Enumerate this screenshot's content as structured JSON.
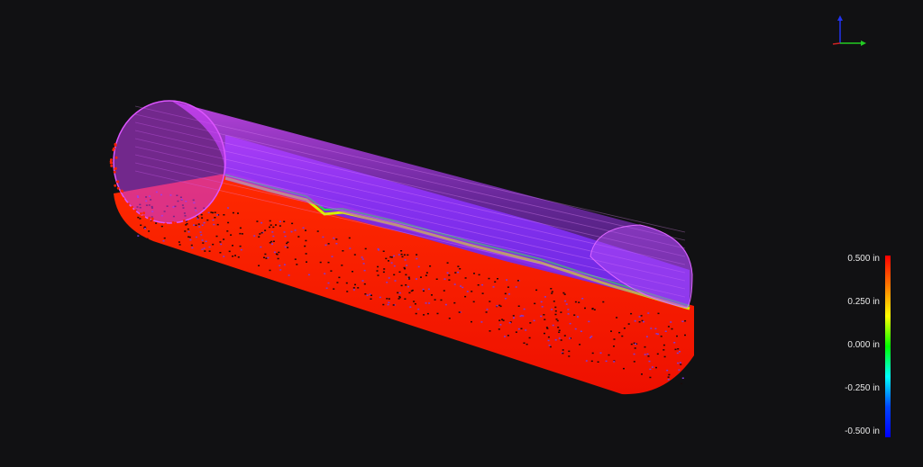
{
  "viewport": {
    "background": "#111113",
    "pipe_color": "#cc33ff",
    "scan_colors": {
      "high": "#ff1a00",
      "mid": "#ffe200",
      "zero": "#22dd33",
      "low": "#1111ee",
      "pipe_tint": "#8a3aff"
    }
  },
  "axes_triad": {
    "x_color": "#22cc22",
    "y_color": "#cc2222",
    "z_color": "#2233ee"
  },
  "legend": {
    "unit": "in",
    "ticks": [
      "0.500 in",
      "0.250 in",
      "0.000 in",
      "-0.250 in",
      "-0.500 in"
    ],
    "range": [
      -0.5,
      0.5
    ],
    "gradient": [
      "#ff0000",
      "#ff7a00",
      "#ffff00",
      "#00ff00",
      "#00ffff",
      "#0044ff",
      "#0000ff"
    ]
  }
}
